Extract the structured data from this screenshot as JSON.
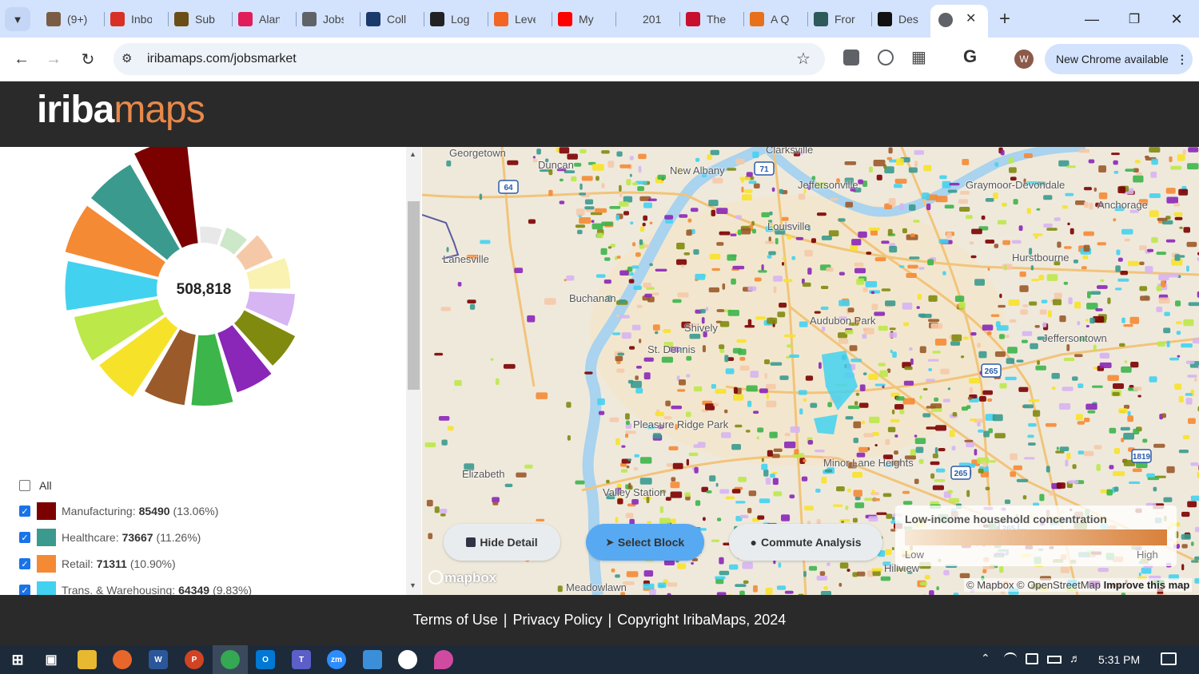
{
  "browser": {
    "tabs": [
      {
        "label": "(9+)",
        "icon": "person-icon",
        "color": "#7a5c44"
      },
      {
        "label": "Inbox",
        "icon": "gmail-icon",
        "color": "#d93025"
      },
      {
        "label": "Sub",
        "icon": "bag-icon",
        "color": "#6b4e16"
      },
      {
        "label": "Alan",
        "icon": "slack-icon",
        "color": "#e01e5a"
      },
      {
        "label": "Jobs",
        "icon": "globe-icon",
        "color": "#5f6368"
      },
      {
        "label": "Coll",
        "icon": "c-icon",
        "color": "#1a3a6b"
      },
      {
        "label": "Log",
        "icon": "pen-icon",
        "color": "#222"
      },
      {
        "label": "Leve",
        "icon": "levels-icon",
        "color": "#f26522"
      },
      {
        "label": "My",
        "icon": "youtube-icon",
        "color": "#ff0000"
      },
      {
        "label": "201",
        "icon": "blank-icon",
        "color": "#d3e3fd"
      },
      {
        "label": "The",
        "icon": "a-icon",
        "color": "#c8102e"
      },
      {
        "label": "A Q",
        "icon": "ihe-icon",
        "color": "#e8701a"
      },
      {
        "label": "Fror",
        "icon": "book-icon",
        "color": "#2d5a5a"
      },
      {
        "label": "Des",
        "icon": "wsj-icon",
        "color": "#111"
      }
    ],
    "url": "iribamaps.com/jobsmarket",
    "new_chrome": "New Chrome available",
    "profile_initial": "W"
  },
  "site": {
    "logo_part1": "iriba",
    "logo_part2": "maps"
  },
  "panel": {
    "total": "508,818",
    "all_label": "All",
    "legend": [
      {
        "name": "Manufacturing:",
        "value": "85490",
        "pct": "(13.06%)",
        "color": "#7b0000"
      },
      {
        "name": "Healthcare:",
        "value": "73667",
        "pct": "(11.26%)",
        "color": "#3a9a8e"
      },
      {
        "name": "Retail:",
        "value": "71311",
        "pct": "(10.90%)",
        "color": "#f58a34"
      },
      {
        "name": "Trans. & Warehousing:",
        "value": "64349",
        "pct": "(9.83%)",
        "color": "#43d1f0"
      }
    ]
  },
  "chart_data": {
    "type": "pie",
    "style": "polar-area",
    "total": 508818,
    "slices": [
      {
        "color": "#7b0000",
        "value": 85490,
        "label": "Manufacturing"
      },
      {
        "color": "#3a9a8e",
        "value": 73667,
        "label": "Healthcare"
      },
      {
        "color": "#f58a34",
        "value": 71311,
        "label": "Retail"
      },
      {
        "color": "#43d1f0",
        "value": 64349,
        "label": "Trans. & Warehousing"
      },
      {
        "color": "#bde84a",
        "value": 56000
      },
      {
        "color": "#f7e22a",
        "value": 52000
      },
      {
        "color": "#9a5a2a",
        "value": 39000
      },
      {
        "color": "#3cb54a",
        "value": 38000
      },
      {
        "color": "#8a26b8",
        "value": 30000
      },
      {
        "color": "#808a0e",
        "value": 25000
      },
      {
        "color": "#d7b4f2",
        "value": 16000
      },
      {
        "color": "#f9f2b0",
        "value": 13000
      },
      {
        "color": "#f5c9a8",
        "value": 7000
      },
      {
        "color": "#cde8c8",
        "value": 3000
      },
      {
        "color": "#e8e8e8",
        "value": 2000
      }
    ]
  },
  "map": {
    "places": [
      {
        "name": "Georgetown"
      },
      {
        "name": "Duncan"
      },
      {
        "name": "New Albany"
      },
      {
        "name": "Jeffersonville"
      },
      {
        "name": "Clarksville"
      },
      {
        "name": "Graymoor-Devondale"
      },
      {
        "name": "Anchorage"
      },
      {
        "name": "Hurstbourne"
      },
      {
        "name": "Lanesville"
      },
      {
        "name": "Buchanan"
      },
      {
        "name": "Louisville"
      },
      {
        "name": "Shively"
      },
      {
        "name": "St. Dennis"
      },
      {
        "name": "Audubon Park"
      },
      {
        "name": "Jeffersontown"
      },
      {
        "name": "Pleasure Ridge Park"
      },
      {
        "name": "Elizabeth"
      },
      {
        "name": "Valley Station"
      },
      {
        "name": "Minor Lane Heights"
      },
      {
        "name": "Hillview"
      },
      {
        "name": "Meadowlawn"
      }
    ],
    "buttons": {
      "hide_detail": "Hide Detail",
      "select_block": "Select Block",
      "commute": "Commute Analysis"
    },
    "legend_title": "Low-income household concentration",
    "legend_low": "Low",
    "legend_high": "High",
    "attribution": "© Mapbox © OpenStreetMap",
    "improve": "Improve this map",
    "mapbox_logo": "mapbox",
    "shields": [
      "64",
      "71",
      "265",
      "265",
      "265",
      "1819"
    ]
  },
  "footer": {
    "terms": "Terms of Use",
    "privacy": "Privacy Policy",
    "copyright": "Copyright IribaMaps, 2024",
    "sep": "|"
  },
  "taskbar": {
    "time": "5:31 PM"
  }
}
